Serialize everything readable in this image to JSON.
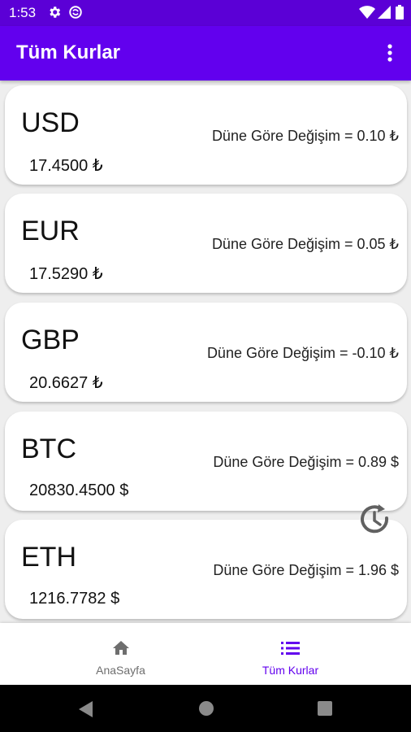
{
  "status_bar": {
    "time": "1:53"
  },
  "app_bar": {
    "title": "Tüm Kurlar"
  },
  "rates": [
    {
      "code": "USD",
      "price": "17.4500 ₺",
      "change": "Düne Göre Değişim = 0.10 ₺"
    },
    {
      "code": "EUR",
      "price": "17.5290 ₺",
      "change": "Düne Göre Değişim = 0.05 ₺"
    },
    {
      "code": "GBP",
      "price": "20.6627 ₺",
      "change": "Düne Göre Değişim = -0.10 ₺"
    },
    {
      "code": "BTC",
      "price": "20830.4500 $",
      "change": "Düne Göre Değişim = 0.89 $"
    },
    {
      "code": "ETH",
      "price": "1216.7782 $",
      "change": "Düne Göre Değişim = 1.96 $"
    }
  ],
  "bottom_nav": {
    "items": [
      {
        "label": "AnaSayfa",
        "icon": "home-icon",
        "active": false
      },
      {
        "label": "Tüm Kurlar",
        "icon": "list-icon",
        "active": true
      }
    ]
  },
  "colors": {
    "status_bar": "#5b00d6",
    "app_bar": "#6200ee",
    "active_nav": "#6200ee",
    "inactive_nav": "#6e6e6e"
  }
}
